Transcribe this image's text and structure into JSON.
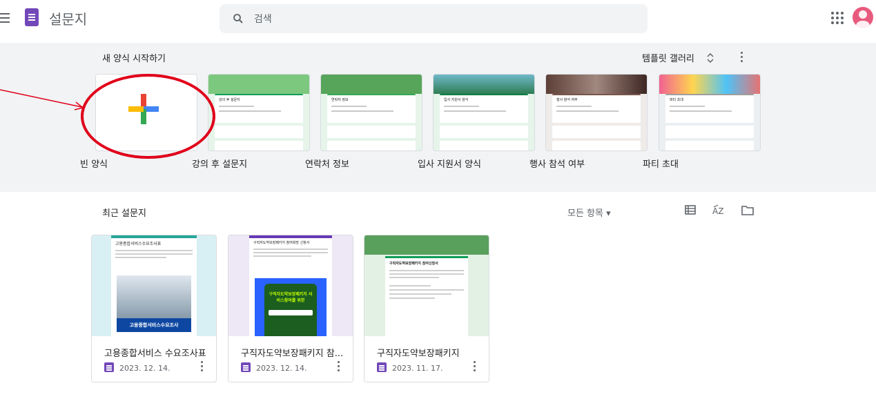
{
  "header": {
    "app_title": "설문지",
    "search_placeholder": "검색"
  },
  "templates": {
    "section_title": "새 양식 시작하기",
    "gallery_label": "템플릿 갤러리",
    "items": [
      {
        "label": "빈 양식"
      },
      {
        "label": "강의 후 설문지",
        "thumb_title": "강의 후 설문지",
        "accent": "#0f9d58"
      },
      {
        "label": "연락처 정보",
        "thumb_title": "연락처 정보",
        "accent": "#34a853"
      },
      {
        "label": "입사 지원서 양식",
        "thumb_title": "입사 지원서 양식",
        "accent": "#0b8043"
      },
      {
        "label": "행사 참석 여부",
        "thumb_title": "행사 참석 여부",
        "accent": "#795548"
      },
      {
        "label": "파티 초대",
        "thumb_title": "파티 초대",
        "accent": "#9e9e9e"
      }
    ]
  },
  "recent": {
    "section_title": "최근 설문지",
    "owner_filter": "모든 항목 ▾",
    "items": [
      {
        "name": "고용종합서비스 수요조사표",
        "date": "2023. 12. 14.",
        "thumb_heading": "고용종합서비스수요조사표",
        "thumb_caption": "고용종합서비스수요조사"
      },
      {
        "name": "구직자도약보장패키지 참...",
        "date": "2023. 12. 14.",
        "thumb_heading": "구직자도약보장패키지 참여희망 신청서",
        "thumb_caption": "구직자도약보장패키지 서비스참여를 위한"
      },
      {
        "name": "구직자도약보장패키지",
        "date": "2023. 11. 17.",
        "thumb_heading": "구직자도약보장패키지 참여신청서"
      }
    ]
  },
  "colors": {
    "forms_purple": "#7248b9",
    "annotation_red": "#e0001a",
    "template_bg": "#f1f3f4"
  }
}
